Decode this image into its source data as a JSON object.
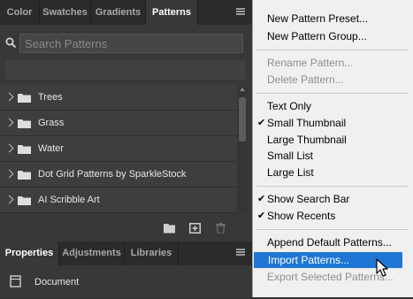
{
  "tabs": [
    "Color",
    "Swatches",
    "Gradients",
    "Patterns"
  ],
  "search": {
    "placeholder": "Search Patterns"
  },
  "groups": [
    "Trees",
    "Grass",
    "Water",
    "Dot Grid Patterns by SparkleStock",
    "AI Scribble Art"
  ],
  "bottom_tabs": [
    "Properties",
    "Adjustments",
    "Libraries"
  ],
  "document_label": "Document",
  "flyout_menu": {
    "new_preset": "New Pattern Preset...",
    "new_group": "New Pattern Group...",
    "rename": "Rename Pattern...",
    "delete": "Delete Pattern...",
    "text_only": "Text Only",
    "small_thumbnail": "Small Thumbnail",
    "large_thumbnail": "Large Thumbnail",
    "small_list": "Small List",
    "large_list": "Large List",
    "show_search_bar": "Show Search Bar",
    "show_recents": "Show Recents",
    "append_default": "Append Default Patterns...",
    "import": "Import Patterns...",
    "export_selected": "Export Selected Patterns..."
  },
  "checked_items": [
    "Small Thumbnail",
    "Show Search Bar",
    "Show Recents"
  ],
  "highlighted_item": "Import Patterns...",
  "colors": {
    "panel_bg": "#383838",
    "menu_bg": "#f0f0f0",
    "highlight": "#1f76d4"
  }
}
